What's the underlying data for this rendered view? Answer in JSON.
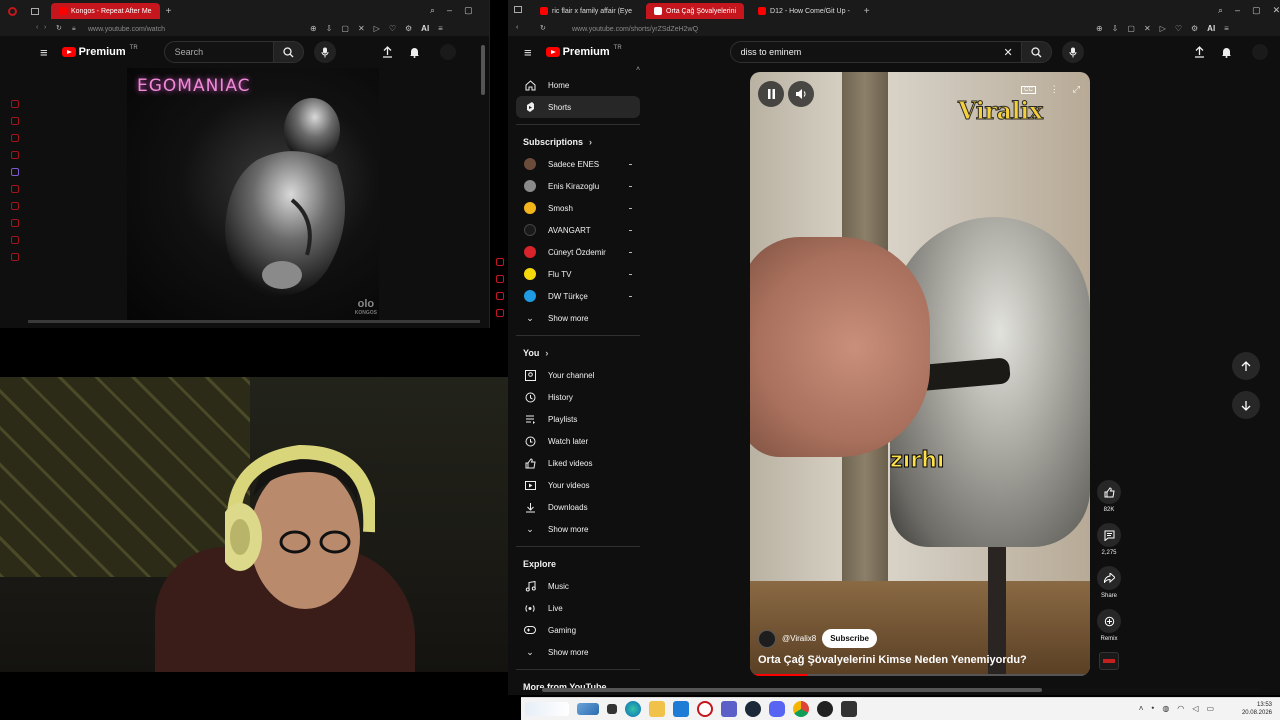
{
  "left_browser": {
    "tab_title": "Kongos - Repeat After Me",
    "new_tab": "+",
    "address": "www.youtube.com/watch",
    "search_placeholder": "Search",
    "logo": "Premium",
    "logo_region": "TR",
    "ai_label": "AI",
    "album": {
      "title": "EGOMANIAC",
      "mark": "olo",
      "mark_sub": "KONGOS"
    }
  },
  "right_browser": {
    "tabs": [
      {
        "title": "ric flair x family affair (Eye"
      },
      {
        "title": "Orta Çağ Şövalyelerini"
      },
      {
        "title": "D12 - How Come/Git Up -"
      }
    ],
    "new_tab": "+",
    "address": "www.youtube.com/shorts/yrZSdZeH2wQ",
    "logo": "Premium",
    "logo_region": "TR",
    "search_value": "diss to eminem",
    "guide": {
      "main": [
        {
          "label": "Home",
          "icon": "home-icon"
        },
        {
          "label": "Shorts",
          "icon": "shorts-icon"
        }
      ],
      "subscriptions_header": "Subscriptions",
      "subscriptions": [
        {
          "label": "Sadece ENES",
          "color": "#6b4b3a"
        },
        {
          "label": "Enis Kirazoglu",
          "color": "#8a8a8a"
        },
        {
          "label": "Smosh",
          "color": "#f2b51b"
        },
        {
          "label": "AVANGART",
          "color": "#1a1a1a"
        },
        {
          "label": "Cüneyt Özdemir",
          "color": "#d8232a"
        },
        {
          "label": "Flu TV",
          "color": "#f5d90a"
        },
        {
          "label": "DW Türkçe",
          "color": "#1e9be2"
        }
      ],
      "show_more_1": "Show more",
      "you_header": "You",
      "you": [
        {
          "label": "Your channel",
          "icon": "your-channel-icon"
        },
        {
          "label": "History",
          "icon": "history-icon"
        },
        {
          "label": "Playlists",
          "icon": "playlists-icon"
        },
        {
          "label": "Watch later",
          "icon": "watch-later-icon"
        },
        {
          "label": "Liked videos",
          "icon": "liked-videos-icon"
        },
        {
          "label": "Your videos",
          "icon": "your-videos-icon"
        },
        {
          "label": "Downloads",
          "icon": "downloads-icon"
        }
      ],
      "show_more_2": "Show more",
      "explore_header": "Explore",
      "explore": [
        {
          "label": "Music",
          "icon": "music-icon"
        },
        {
          "label": "Live",
          "icon": "live-icon"
        },
        {
          "label": "Gaming",
          "icon": "gaming-icon"
        }
      ],
      "show_more_3": "Show more",
      "more_header": "More from YouTube"
    },
    "short": {
      "watermark": "Viralix",
      "caption": "zırhı",
      "channel": "@Viralix8",
      "subscribe": "Subscribe",
      "title": "Orta Çağ Şövalyelerini Kimse Neden Yenemiyordu?",
      "progress": 0.17
    },
    "actions": {
      "likes": "82K",
      "comments": "2,275",
      "share": "Share",
      "remix": "Remix"
    }
  },
  "taskbar": {
    "time": "13:53",
    "date": "20.08.2026"
  }
}
